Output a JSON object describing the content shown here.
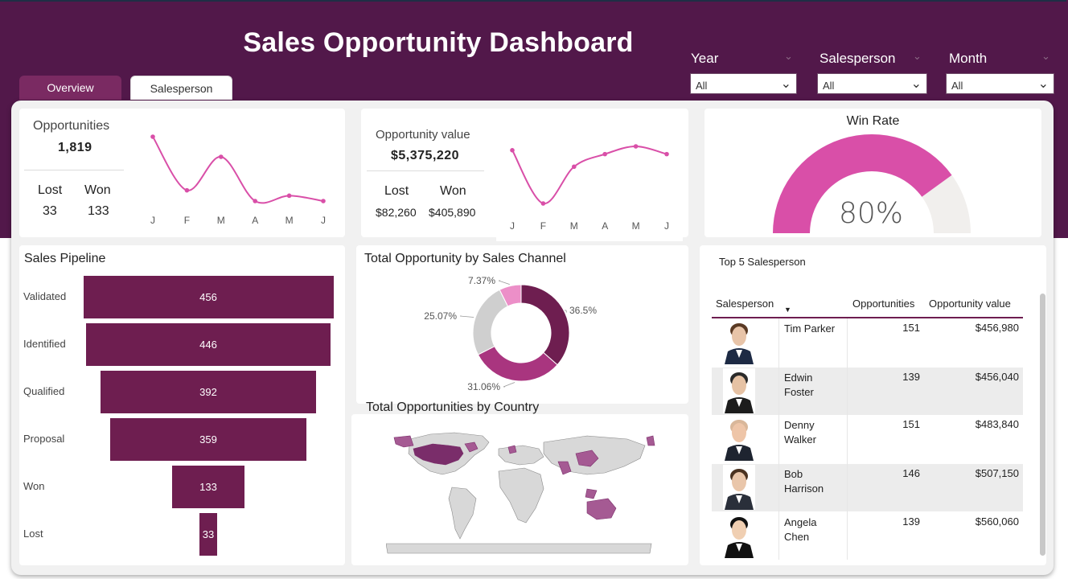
{
  "header": {
    "title": "Sales Opportunity Dashboard"
  },
  "tabs": [
    {
      "label": "Overview"
    },
    {
      "label": "Salesperson"
    }
  ],
  "filters": [
    {
      "label": "Year",
      "value": "All"
    },
    {
      "label": "Salesperson",
      "value": "All"
    },
    {
      "label": "Month",
      "value": "All"
    }
  ],
  "kpi_opportunities": {
    "label": "Opportunities",
    "value": "1,819",
    "lost_label": "Lost",
    "lost_value": "33",
    "won_label": "Won",
    "won_value": "133"
  },
  "kpi_value": {
    "label": "Opportunity value",
    "value": "$5,375,220",
    "lost_label": "Lost",
    "lost_value": "$82,260",
    "won_label": "Won",
    "won_value": "$405,890"
  },
  "win_rate": {
    "title": "Win Rate",
    "value": "80%",
    "fraction": 0.8
  },
  "pipeline_title": "Sales Pipeline",
  "donut_title": "Total Opportunity by Sales Channel",
  "map_title": "Total Opportunities by Country",
  "top5": {
    "title": "Top 5 Salesperson",
    "headers": {
      "name": "Salesperson",
      "opps": "Opportunities",
      "value": "Opportunity value"
    },
    "rows": [
      {
        "name1": "Tim Parker",
        "name2": "",
        "opps": "151",
        "value": "$456,980"
      },
      {
        "name1": "Edwin",
        "name2": "Foster",
        "opps": "139",
        "value": "$456,040"
      },
      {
        "name1": "Denny",
        "name2": "Walker",
        "opps": "151",
        "value": "$483,840"
      },
      {
        "name1": "Bob",
        "name2": "Harrison",
        "opps": "146",
        "value": "$507,150"
      },
      {
        "name1": "Angela",
        "name2": "Chen",
        "opps": "139",
        "value": "$560,060"
      }
    ]
  },
  "colors": {
    "header": "#52184a",
    "accent": "#d94fa8",
    "bar": "#6e1e50",
    "gauge_bg": "#f1efed"
  },
  "chart_data": [
    {
      "type": "line",
      "name": "opportunities-trend",
      "x": [
        "J",
        "F",
        "M",
        "A",
        "M",
        "J"
      ],
      "values": [
        98,
        58,
        83,
        50,
        54,
        50
      ]
    },
    {
      "type": "line",
      "name": "value-trend",
      "x": [
        "J",
        "F",
        "M",
        "A",
        "M",
        "J"
      ],
      "values": [
        80,
        25,
        63,
        76,
        84,
        76
      ]
    },
    {
      "type": "bar",
      "name": "sales-pipeline",
      "categories": [
        "Validated",
        "Identified",
        "Qualified",
        "Proposal",
        "Won",
        "Lost"
      ],
      "values": [
        456,
        446,
        392,
        359,
        133,
        33
      ]
    },
    {
      "type": "pie",
      "name": "sales-channel",
      "labels": [
        "36.5%",
        "31.06%",
        "25.07%",
        "7.37%"
      ],
      "values": [
        36.5,
        31.06,
        25.07,
        7.37
      ],
      "colors": [
        "#6e1e50",
        "#a9357f",
        "#cfcfcf",
        "#ec8fc8"
      ]
    }
  ]
}
